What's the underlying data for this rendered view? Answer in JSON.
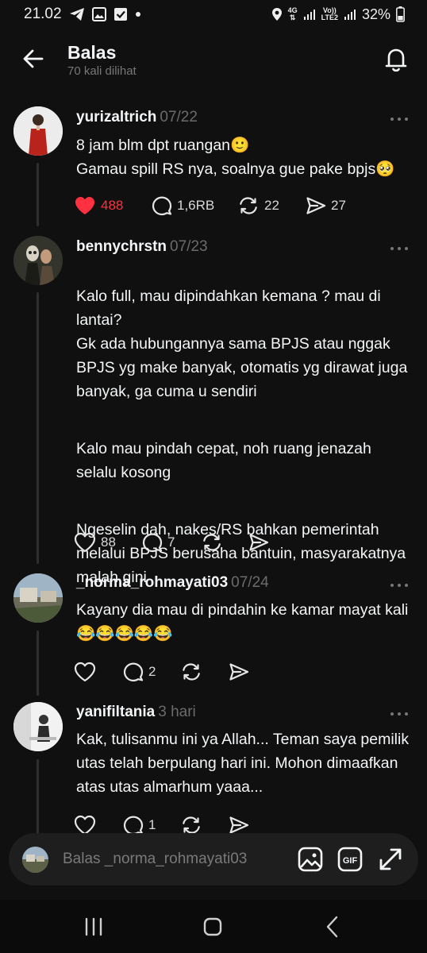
{
  "status": {
    "time": "21.02",
    "net1": "4G",
    "net2_top": "Vo))",
    "net2_bottom": "LTE2",
    "battery": "32%"
  },
  "header": {
    "title": "Balas",
    "subtitle": "70 kali dilihat"
  },
  "threads": [
    {
      "username": "yurizaltrich",
      "time": "07/22",
      "body": "8 jam blm dpt ruangan🙂\nGamau spill RS nya, soalnya gue pake bpjs🥺",
      "like_count": "488",
      "liked": true,
      "reply_count": "1,6RB",
      "repost_count": "22",
      "share_count": "27"
    },
    {
      "username": "bennychrstn",
      "time": "07/23",
      "paragraphs": [
        "Kalo full, mau dipindahkan kemana ? mau di lantai?\nGk ada hubungannya sama BPJS atau nggak BPJS yg make banyak, otomatis yg dirawat juga banyak, ga cuma u sendiri",
        "Kalo mau pindah cepat, noh ruang jenazah selalu kosong",
        "Ngeselin dah, nakes/RS bahkan pemerintah melalui BPJS berusaha bantuin, masyarakatnya malah gini"
      ],
      "like_count": "88",
      "reply_count": "7"
    },
    {
      "username": "_norma_rohmayati03",
      "time": "07/24",
      "body": "Kayany dia mau di pindahin ke kamar mayat kali 😂😂😂😂😂",
      "reply_count": "2"
    },
    {
      "username": "yanifiltania",
      "time": "3 hari",
      "body": "Kak, tulisanmu ini ya Allah... Teman saya pemilik utas telah berpulang hari ini. Mohon dimaafkan atas utas almarhum yaaa...",
      "reply_count": "1"
    }
  ],
  "reply_bar": {
    "placeholder": "Balas _norma_rohmayati03",
    "gif_label": "GIF"
  },
  "colors": {
    "background": "#101010",
    "like_red": "#ff3040",
    "muted": "#777777"
  },
  "icons": [
    "back-arrow-icon",
    "bell-icon",
    "more-icon",
    "heart-icon",
    "comment-icon",
    "repost-icon",
    "share-icon",
    "image-icon",
    "gif-icon",
    "expand-icon",
    "recents-icon",
    "home-icon",
    "nav-back-icon"
  ]
}
